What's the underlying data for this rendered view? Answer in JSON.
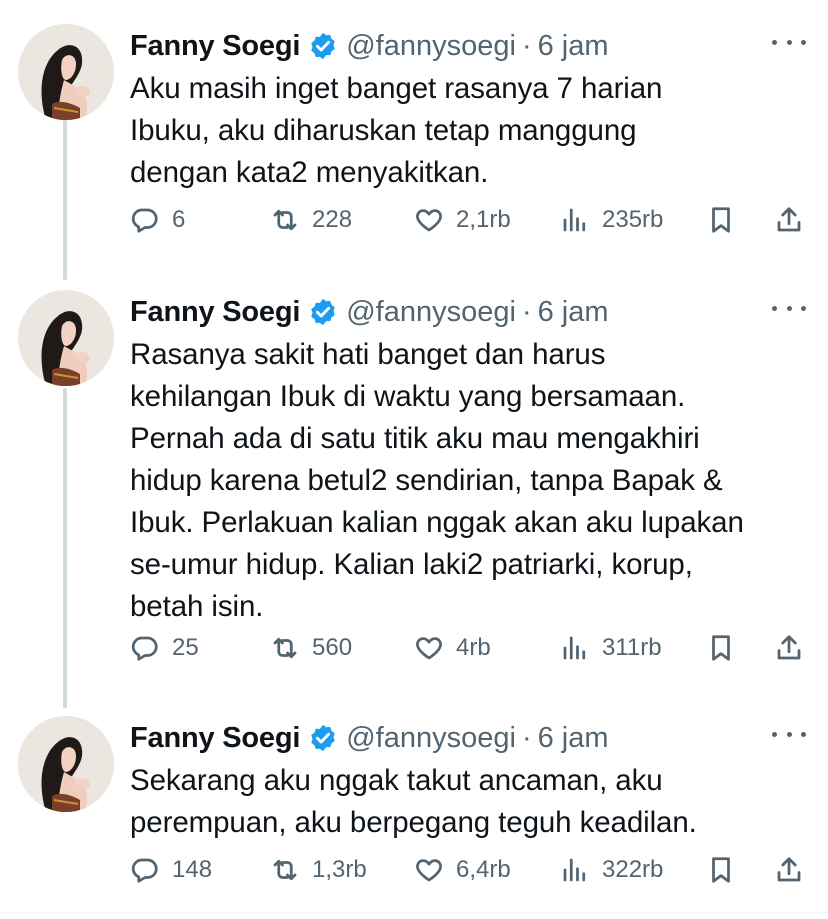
{
  "tweets": [
    {
      "name": "Fanny Soegi",
      "handle": "@fannysoegi",
      "dot": "·",
      "time": "6 jam",
      "text": "Aku masih inget banget rasanya 7 harian\nIbuku, aku diharuskan tetap manggung\ndengan kata2 menyakitkan.",
      "replies": "6",
      "retweets": "228",
      "likes": "2,1rb",
      "views": "235rb"
    },
    {
      "name": "Fanny Soegi",
      "handle": "@fannysoegi",
      "dot": "·",
      "time": "6 jam",
      "text": "Rasanya sakit hati banget dan harus\nkehilangan Ibuk di waktu yang bersamaan.\nPernah ada di satu titik aku mau mengakhiri\nhidup karena betul2 sendirian, tanpa Bapak &\nIbuk. Perlakuan kalian nggak akan aku lupakan\nse-umur hidup. Kalian laki2 patriarki, korup,\nbetah isin.",
      "replies": "25",
      "retweets": "560",
      "likes": "4rb",
      "views": "311rb"
    },
    {
      "name": "Fanny Soegi",
      "handle": "@fannysoegi",
      "dot": "·",
      "time": "6 jam",
      "text": "Sekarang aku nggak takut ancaman, aku\nperempuan, aku berpegang teguh keadilan.",
      "replies": "148",
      "retweets": "1,3rb",
      "likes": "6,4rb",
      "views": "322rb"
    }
  ],
  "colors": {
    "verified": "#1d9bf0",
    "muted": "#536471",
    "text": "#0f1419",
    "thread_line": "#cfd9de"
  },
  "icons": [
    "reply-icon",
    "retweet-icon",
    "like-icon",
    "views-icon",
    "bookmark-icon",
    "share-icon",
    "verified-badge-icon",
    "more-icon"
  ]
}
